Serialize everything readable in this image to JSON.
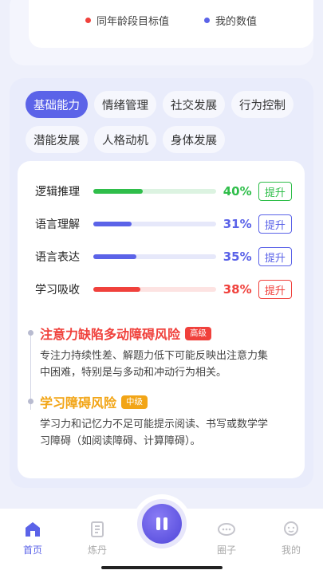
{
  "legend": {
    "items": [
      {
        "label": "同年龄段目标值",
        "color": "#f0413c"
      },
      {
        "label": "我的数值",
        "color": "#5b63e8"
      }
    ]
  },
  "tabs": [
    {
      "label": "基础能力",
      "active": true
    },
    {
      "label": "情绪管理",
      "active": false
    },
    {
      "label": "社交发展",
      "active": false
    },
    {
      "label": "行为控制",
      "active": false
    },
    {
      "label": "潜能发展",
      "active": false
    },
    {
      "label": "人格动机",
      "active": false
    },
    {
      "label": "身体发展",
      "active": false
    }
  ],
  "metrics": [
    {
      "label": "逻辑推理",
      "percent": "40%",
      "value": 0.4,
      "color": "#2fbe4a",
      "track": "#dcf3e1",
      "button": "提升"
    },
    {
      "label": "语言理解",
      "percent": "31%",
      "value": 0.31,
      "color": "#5b63e8",
      "track": "#e6e8fa",
      "button": "提升"
    },
    {
      "label": "语言表达",
      "percent": "35%",
      "value": 0.35,
      "color": "#5b63e8",
      "track": "#e6e8fa",
      "button": "提升"
    },
    {
      "label": "学习吸收",
      "percent": "38%",
      "value": 0.38,
      "color": "#f0413c",
      "track": "#fde3e2",
      "button": "提升"
    }
  ],
  "risks": [
    {
      "title": "注意力缺陷多动障碍风险",
      "badge": "高级",
      "color": "#f0413c",
      "badge_color": "#f0413c",
      "desc": "专注力持续性差、解题力低下可能反映出注意力集中困难，特别是与多动和冲动行为相关。"
    },
    {
      "title": "学习障碍风险",
      "badge": "中级",
      "color": "#f2a516",
      "badge_color": "#f2a516",
      "desc": "学习力和记忆力不足可能提示阅读、书写或数学学习障碍（如阅读障碍、计算障碍）。"
    }
  ],
  "nav": [
    {
      "label": "首页",
      "active": true
    },
    {
      "label": "炼丹",
      "active": false
    },
    {
      "label": "圈子",
      "active": false
    },
    {
      "label": "我的",
      "active": false
    }
  ],
  "colors": {
    "accent": "#5b63e8"
  }
}
